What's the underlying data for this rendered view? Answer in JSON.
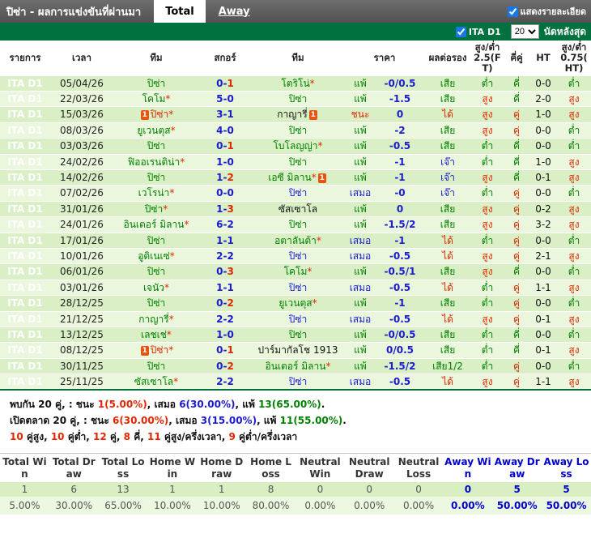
{
  "colors": {
    "g": "#008000",
    "r": "#e02800",
    "b": "#1b1bd0",
    "k": "#111111"
  },
  "header": {
    "title": "ปิซ่า - ผลการแข่งขันที่ผ่านมา",
    "tabs": [
      {
        "label": "Total",
        "active": true
      },
      {
        "label": "Away",
        "active": false
      }
    ],
    "detail_checkbox_label": "แสดงรายละเอียด"
  },
  "filter": {
    "league_label": "ITA D1",
    "match_count": "20",
    "suffix_label": "นัดหลังสุด"
  },
  "icons": {
    "red_card": "1"
  },
  "table": {
    "headers": {
      "league": "รายการ",
      "time": "เวลา",
      "team_home": "ทีม",
      "score": "สกอร์",
      "team_away": "ทีม",
      "price": "ราคา",
      "hdp_result": "ผลต่อรอง",
      "ou_ft": "สูง/ต่ำ 2.5(FT)",
      "odd_even": "คี่คู่",
      "ht": "HT",
      "ou_ht": "สูง/ต่ำ 0.75(HT)"
    },
    "rows": [
      {
        "lg": "ITA D1",
        "d": "05/04/26",
        "h": {
          "n": "ปิซ่า",
          "c": "g"
        },
        "s": [
          [
            "0-",
            "b"
          ],
          [
            "1",
            "r"
          ]
        ],
        "a": {
          "n": "โตริโน่",
          "c": "g",
          "star": true
        },
        "res": [
          "แพ้",
          "g"
        ],
        "hdp": "-0/0.5",
        "hr": [
          "เสีย",
          "g"
        ],
        "ou": [
          "ต่ำ",
          "g"
        ],
        "oe": [
          "คี่",
          "g"
        ],
        "ht": "0-0",
        "oh": [
          "ต่ำ",
          "g"
        ]
      },
      {
        "lg": "ITA D1",
        "d": "22/03/26",
        "h": {
          "n": "โคโม",
          "c": "g",
          "star": true
        },
        "s": [
          [
            "5-0",
            "b"
          ]
        ],
        "a": {
          "n": "ปิซ่า",
          "c": "g"
        },
        "res": [
          "แพ้",
          "g"
        ],
        "hdp": "-1.5",
        "hr": [
          "เสีย",
          "g"
        ],
        "ou": [
          "สูง",
          "r"
        ],
        "oe": [
          "คี่",
          "g"
        ],
        "ht": "2-0",
        "oh": [
          "สูง",
          "r"
        ]
      },
      {
        "lg": "ITA D1",
        "d": "15/03/26",
        "h": {
          "n": "ปิซ่า",
          "c": "r",
          "star": true,
          "card": true
        },
        "s": [
          [
            "3-1",
            "b"
          ]
        ],
        "a": {
          "n": "กาญารี่",
          "c": "k",
          "card": true
        },
        "res": [
          "ชนะ",
          "r"
        ],
        "hdp": "0",
        "hr": [
          "ได้",
          "r"
        ],
        "ou": [
          "สูง",
          "r"
        ],
        "oe": [
          "คู่",
          "r"
        ],
        "ht": "1-0",
        "oh": [
          "สูง",
          "r"
        ]
      },
      {
        "lg": "ITA D1",
        "d": "08/03/26",
        "h": {
          "n": "ยูเวนตุส",
          "c": "g",
          "star": true
        },
        "s": [
          [
            "4-0",
            "b"
          ]
        ],
        "a": {
          "n": "ปิซ่า",
          "c": "g"
        },
        "res": [
          "แพ้",
          "g"
        ],
        "hdp": "-2",
        "hr": [
          "เสีย",
          "g"
        ],
        "ou": [
          "สูง",
          "r"
        ],
        "oe": [
          "คู่",
          "r"
        ],
        "ht": "0-0",
        "oh": [
          "ต่ำ",
          "g"
        ]
      },
      {
        "lg": "ITA D1",
        "d": "03/03/26",
        "h": {
          "n": "ปิซ่า",
          "c": "g"
        },
        "s": [
          [
            "0-",
            "b"
          ],
          [
            "1",
            "r"
          ]
        ],
        "a": {
          "n": "โบโลญญ่า",
          "c": "g",
          "star": true
        },
        "res": [
          "แพ้",
          "g"
        ],
        "hdp": "-0.5",
        "hr": [
          "เสีย",
          "g"
        ],
        "ou": [
          "ต่ำ",
          "g"
        ],
        "oe": [
          "คี่",
          "g"
        ],
        "ht": "0-0",
        "oh": [
          "ต่ำ",
          "g"
        ]
      },
      {
        "lg": "ITA D1",
        "d": "24/02/26",
        "h": {
          "n": "ฟิออเรนติน่า",
          "c": "g",
          "star": true
        },
        "s": [
          [
            "1-0",
            "b"
          ]
        ],
        "a": {
          "n": "ปิซ่า",
          "c": "g"
        },
        "res": [
          "แพ้",
          "g"
        ],
        "hdp": "-1",
        "hr": [
          "เจ๊า",
          "b"
        ],
        "ou": [
          "ต่ำ",
          "g"
        ],
        "oe": [
          "คี่",
          "g"
        ],
        "ht": "1-0",
        "oh": [
          "สูง",
          "r"
        ]
      },
      {
        "lg": "ITA D1",
        "d": "14/02/26",
        "h": {
          "n": "ปิซ่า",
          "c": "g"
        },
        "s": [
          [
            "1-",
            "b"
          ],
          [
            "2",
            "r"
          ]
        ],
        "a": {
          "n": "เอซี มิลาน",
          "c": "g",
          "star": true,
          "card": true
        },
        "res": [
          "แพ้",
          "g"
        ],
        "hdp": "-1",
        "hr": [
          "เจ๊า",
          "b"
        ],
        "ou": [
          "สูง",
          "r"
        ],
        "oe": [
          "คี่",
          "g"
        ],
        "ht": "0-1",
        "oh": [
          "สูง",
          "r"
        ]
      },
      {
        "lg": "ITA D1",
        "d": "07/02/26",
        "h": {
          "n": "เวโรน่า",
          "c": "g",
          "star": true
        },
        "s": [
          [
            "0-0",
            "b"
          ]
        ],
        "a": {
          "n": "ปิซ่า",
          "c": "b"
        },
        "res": [
          "เสมอ",
          "b"
        ],
        "hdp": "-0",
        "hr": [
          "เจ๊า",
          "b"
        ],
        "ou": [
          "ต่ำ",
          "g"
        ],
        "oe": [
          "คู่",
          "r"
        ],
        "ht": "0-0",
        "oh": [
          "ต่ำ",
          "g"
        ]
      },
      {
        "lg": "ITA D1",
        "d": "31/01/26",
        "h": {
          "n": "ปิซ่า",
          "c": "g",
          "star": true
        },
        "s": [
          [
            "1-",
            "b"
          ],
          [
            "3",
            "r"
          ]
        ],
        "a": {
          "n": "ซัสเซาโล",
          "c": "k"
        },
        "res": [
          "แพ้",
          "g"
        ],
        "hdp": "0",
        "hr": [
          "เสีย",
          "g"
        ],
        "ou": [
          "สูง",
          "r"
        ],
        "oe": [
          "คู่",
          "r"
        ],
        "ht": "0-2",
        "oh": [
          "สูง",
          "r"
        ]
      },
      {
        "lg": "ITA D1",
        "d": "24/01/26",
        "h": {
          "n": "อินเตอร์ มิลาน",
          "c": "g",
          "star": true
        },
        "s": [
          [
            "6-2",
            "b"
          ]
        ],
        "a": {
          "n": "ปิซ่า",
          "c": "g"
        },
        "res": [
          "แพ้",
          "g"
        ],
        "hdp": "-1.5/2",
        "hr": [
          "เสีย",
          "g"
        ],
        "ou": [
          "สูง",
          "r"
        ],
        "oe": [
          "คู่",
          "r"
        ],
        "ht": "3-2",
        "oh": [
          "สูง",
          "r"
        ]
      },
      {
        "lg": "ITA D1",
        "d": "17/01/26",
        "h": {
          "n": "ปิซ่า",
          "c": "g"
        },
        "s": [
          [
            "1-1",
            "b"
          ]
        ],
        "a": {
          "n": "อตาลันต้า",
          "c": "g",
          "star": true
        },
        "res": [
          "เสมอ",
          "b"
        ],
        "hdp": "-1",
        "hr": [
          "ได้",
          "r"
        ],
        "ou": [
          "ต่ำ",
          "g"
        ],
        "oe": [
          "คู่",
          "r"
        ],
        "ht": "0-0",
        "oh": [
          "ต่ำ",
          "g"
        ]
      },
      {
        "lg": "ITA D1",
        "d": "10/01/26",
        "h": {
          "n": "อูดิเนเซ่",
          "c": "g",
          "star": true
        },
        "s": [
          [
            "2-2",
            "b"
          ]
        ],
        "a": {
          "n": "ปิซ่า",
          "c": "b"
        },
        "res": [
          "เสมอ",
          "b"
        ],
        "hdp": "-0.5",
        "hr": [
          "ได้",
          "r"
        ],
        "ou": [
          "สูง",
          "r"
        ],
        "oe": [
          "คู่",
          "r"
        ],
        "ht": "2-1",
        "oh": [
          "สูง",
          "r"
        ]
      },
      {
        "lg": "ITA D1",
        "d": "06/01/26",
        "h": {
          "n": "ปิซ่า",
          "c": "g"
        },
        "s": [
          [
            "0-",
            "b"
          ],
          [
            "3",
            "r"
          ]
        ],
        "a": {
          "n": "โคโม",
          "c": "g",
          "star": true
        },
        "res": [
          "แพ้",
          "g"
        ],
        "hdp": "-0.5/1",
        "hr": [
          "เสีย",
          "g"
        ],
        "ou": [
          "สูง",
          "r"
        ],
        "oe": [
          "คี่",
          "g"
        ],
        "ht": "0-0",
        "oh": [
          "ต่ำ",
          "g"
        ]
      },
      {
        "lg": "ITA D1",
        "d": "03/01/26",
        "h": {
          "n": "เจนัว",
          "c": "g",
          "star": true
        },
        "s": [
          [
            "1-1",
            "b"
          ]
        ],
        "a": {
          "n": "ปิซ่า",
          "c": "b"
        },
        "res": [
          "เสมอ",
          "b"
        ],
        "hdp": "-0.5",
        "hr": [
          "ได้",
          "r"
        ],
        "ou": [
          "ต่ำ",
          "g"
        ],
        "oe": [
          "คู่",
          "r"
        ],
        "ht": "1-1",
        "oh": [
          "สูง",
          "r"
        ]
      },
      {
        "lg": "ITA D1",
        "d": "28/12/25",
        "h": {
          "n": "ปิซ่า",
          "c": "g"
        },
        "s": [
          [
            "0-",
            "b"
          ],
          [
            "2",
            "r"
          ]
        ],
        "a": {
          "n": "ยูเวนตุส",
          "c": "g",
          "star": true
        },
        "res": [
          "แพ้",
          "g"
        ],
        "hdp": "-1",
        "hr": [
          "เสีย",
          "g"
        ],
        "ou": [
          "ต่ำ",
          "g"
        ],
        "oe": [
          "คู่",
          "r"
        ],
        "ht": "0-0",
        "oh": [
          "ต่ำ",
          "g"
        ]
      },
      {
        "lg": "ITA D1",
        "d": "21/12/25",
        "h": {
          "n": "กาญารี่",
          "c": "g",
          "star": true
        },
        "s": [
          [
            "2-2",
            "b"
          ]
        ],
        "a": {
          "n": "ปิซ่า",
          "c": "b"
        },
        "res": [
          "เสมอ",
          "b"
        ],
        "hdp": "-0.5",
        "hr": [
          "ได้",
          "r"
        ],
        "ou": [
          "สูง",
          "r"
        ],
        "oe": [
          "คู่",
          "r"
        ],
        "ht": "0-1",
        "oh": [
          "สูง",
          "r"
        ]
      },
      {
        "lg": "ITA D1",
        "d": "13/12/25",
        "h": {
          "n": "เลชเช่",
          "c": "g",
          "star": true
        },
        "s": [
          [
            "1-0",
            "b"
          ]
        ],
        "a": {
          "n": "ปิซ่า",
          "c": "g"
        },
        "res": [
          "แพ้",
          "g"
        ],
        "hdp": "-0/0.5",
        "hr": [
          "เสีย",
          "g"
        ],
        "ou": [
          "ต่ำ",
          "g"
        ],
        "oe": [
          "คี่",
          "g"
        ],
        "ht": "0-0",
        "oh": [
          "ต่ำ",
          "g"
        ]
      },
      {
        "lg": "ITA D1",
        "d": "08/12/25",
        "h": {
          "n": "ปิซ่า",
          "c": "r",
          "star": true,
          "card": true
        },
        "s": [
          [
            "0-",
            "b"
          ],
          [
            "1",
            "r"
          ]
        ],
        "a": {
          "n": "ปาร์มากัลโช 1913",
          "c": "k"
        },
        "res": [
          "แพ้",
          "g"
        ],
        "hdp": "0/0.5",
        "hr": [
          "เสีย",
          "g"
        ],
        "ou": [
          "ต่ำ",
          "g"
        ],
        "oe": [
          "คี่",
          "g"
        ],
        "ht": "0-1",
        "oh": [
          "สูง",
          "r"
        ]
      },
      {
        "lg": "ITA D1",
        "d": "30/11/25",
        "h": {
          "n": "ปิซ่า",
          "c": "g"
        },
        "s": [
          [
            "0-",
            "b"
          ],
          [
            "2",
            "r"
          ]
        ],
        "a": {
          "n": "อินเตอร์ มิลาน",
          "c": "g",
          "star": true
        },
        "res": [
          "แพ้",
          "g"
        ],
        "hdp": "-1.5/2",
        "hr": [
          "เสีย1/2",
          "g"
        ],
        "ou": [
          "ต่ำ",
          "g"
        ],
        "oe": [
          "คู่",
          "r"
        ],
        "ht": "0-0",
        "oh": [
          "ต่ำ",
          "g"
        ]
      },
      {
        "lg": "ITA D1",
        "d": "25/11/25",
        "h": {
          "n": "ซัสเซาโล",
          "c": "g",
          "star": true
        },
        "s": [
          [
            "2-2",
            "b"
          ]
        ],
        "a": {
          "n": "ปิซ่า",
          "c": "b"
        },
        "res": [
          "เสมอ",
          "b"
        ],
        "hdp": "-0.5",
        "hr": [
          "ได้",
          "r"
        ],
        "ou": [
          "สูง",
          "r"
        ],
        "oe": [
          "คู่",
          "r"
        ],
        "ht": "1-1",
        "oh": [
          "สูง",
          "r"
        ]
      }
    ]
  },
  "summary": {
    "lines": [
      {
        "parts": [
          [
            "พบกัน 20 คู่, : ชนะ ",
            "k"
          ],
          [
            "1(5.00%)",
            "r"
          ],
          [
            ", เสมอ ",
            "k"
          ],
          [
            "6(30.00%)",
            "b"
          ],
          [
            ", แพ้ ",
            "k"
          ],
          [
            "13(65.00%)",
            "g"
          ],
          [
            ".",
            "k"
          ]
        ]
      },
      {
        "parts": [
          [
            "เปิดตลาด 20 คู่, : ชนะ ",
            "k"
          ],
          [
            "6(30.00%)",
            "r"
          ],
          [
            ", เสมอ ",
            "k"
          ],
          [
            "3(15.00%)",
            "b"
          ],
          [
            ", แพ้ ",
            "k"
          ],
          [
            "11(55.00%)",
            "g"
          ],
          [
            ".",
            "k"
          ]
        ]
      },
      {
        "parts": [
          [
            "10",
            "r"
          ],
          [
            " คู่สูง, ",
            "k"
          ],
          [
            "10",
            "r"
          ],
          [
            " คู่ต่ำ, ",
            "k"
          ],
          [
            "12",
            "r"
          ],
          [
            " คู่, ",
            "k"
          ],
          [
            "8",
            "r"
          ],
          [
            " คี่, ",
            "k"
          ],
          [
            "11",
            "r"
          ],
          [
            " คู่สูง/ครึ่งเวลา, ",
            "k"
          ],
          [
            "9",
            "r"
          ],
          [
            " คู่ต่ำ/ครึ่งเวลา",
            "k"
          ]
        ]
      }
    ]
  },
  "stats": {
    "columns": [
      {
        "label": "Total Win",
        "count": "1",
        "pct": "5.00%",
        "away": false
      },
      {
        "label": "Total Draw",
        "count": "6",
        "pct": "30.00%",
        "away": false
      },
      {
        "label": "Total Loss",
        "count": "13",
        "pct": "65.00%",
        "away": false
      },
      {
        "label": "Home Win",
        "count": "1",
        "pct": "10.00%",
        "away": false
      },
      {
        "label": "Home Draw",
        "count": "1",
        "pct": "10.00%",
        "away": false
      },
      {
        "label": "Home Loss",
        "count": "8",
        "pct": "80.00%",
        "away": false
      },
      {
        "label": "Neutral Win",
        "count": "0",
        "pct": "0.00%",
        "away": false
      },
      {
        "label": "Neutral Draw",
        "count": "0",
        "pct": "0.00%",
        "away": false
      },
      {
        "label": "Neutral Loss",
        "count": "0",
        "pct": "0.00%",
        "away": false
      },
      {
        "label": "Away Win",
        "count": "0",
        "pct": "0.00%",
        "away": true
      },
      {
        "label": "Away Draw",
        "count": "5",
        "pct": "50.00%",
        "away": true
      },
      {
        "label": "Away Loss",
        "count": "5",
        "pct": "50.00%",
        "away": true
      }
    ]
  }
}
